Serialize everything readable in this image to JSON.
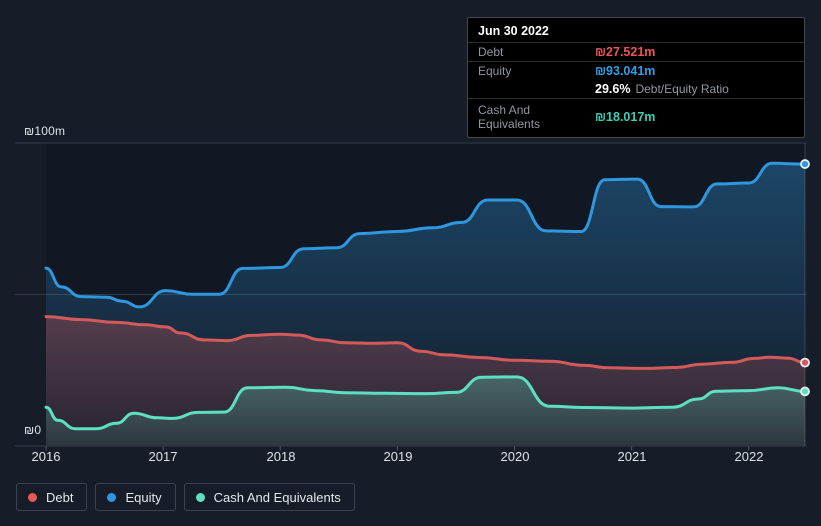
{
  "colors": {
    "background": "#161d28",
    "debt_line": "#d45a5a",
    "equity_line": "#2e97de",
    "cash_line": "#5ce0c1",
    "debt_value_text": "#eb5757",
    "equity_value_text": "#2e9fe6",
    "cash_value_text": "#38d1b7",
    "ratio_value_text": "#ffffff",
    "grid": "#303a47"
  },
  "tooltip": {
    "title": "Jun 30 2022",
    "debt_label": "Debt",
    "debt_value": "₪27.521m",
    "equity_label": "Equity",
    "equity_value": "₪93.041m",
    "ratio_value": "29.6%",
    "ratio_label": "Debt/Equity Ratio",
    "cash_label": "Cash And Equivalents",
    "cash_value": "₪18.017m"
  },
  "axis": {
    "y_top_label": "₪100m",
    "y_zero_label": "₪0",
    "years": [
      "2016",
      "2017",
      "2018",
      "2019",
      "2020",
      "2021",
      "2022"
    ]
  },
  "legend": {
    "items": [
      {
        "label": "Debt",
        "color": "#eb5757"
      },
      {
        "label": "Equity",
        "color": "#2e97de"
      },
      {
        "label": "Cash And Equivalents",
        "color": "#5ce0c1"
      }
    ]
  },
  "chart_data": {
    "type": "area",
    "title": "Debt, Equity and Cash history (₪ millions)",
    "x_range": [
      2016.0,
      2022.48
    ],
    "ylim": [
      0,
      100
    ],
    "y_unit": "₪m",
    "gridlines_y": [
      0,
      50,
      100
    ],
    "x_ticks": [
      2016,
      2017,
      2018,
      2019,
      2020,
      2021,
      2022
    ],
    "legend_position": "bottom-left",
    "last_point_date": "Jun 30 2022",
    "series": [
      {
        "name": "Equity",
        "color": "#2e97de",
        "points": [
          [
            2016.0,
            58.7
          ],
          [
            2016.13,
            52.5
          ],
          [
            2016.3,
            49.3
          ],
          [
            2016.52,
            49.1
          ],
          [
            2016.65,
            47.8
          ],
          [
            2016.8,
            45.9
          ],
          [
            2017.02,
            51.3
          ],
          [
            2017.25,
            50.1
          ],
          [
            2017.48,
            50.1
          ],
          [
            2017.68,
            58.6
          ],
          [
            2018.0,
            58.9
          ],
          [
            2018.2,
            65.1
          ],
          [
            2018.48,
            65.4
          ],
          [
            2018.68,
            70.1
          ],
          [
            2019.0,
            70.8
          ],
          [
            2019.3,
            72.0
          ],
          [
            2019.55,
            73.8
          ],
          [
            2019.77,
            81.2
          ],
          [
            2020.02,
            81.2
          ],
          [
            2020.27,
            71.0
          ],
          [
            2020.57,
            70.8
          ],
          [
            2020.77,
            87.9
          ],
          [
            2021.05,
            88.1
          ],
          [
            2021.25,
            79.0
          ],
          [
            2021.53,
            78.9
          ],
          [
            2021.73,
            86.5
          ],
          [
            2022.0,
            86.8
          ],
          [
            2022.2,
            93.3
          ],
          [
            2022.48,
            93.041
          ]
        ]
      },
      {
        "name": "Debt",
        "color": "#d45a5a",
        "points": [
          [
            2016.0,
            42.7
          ],
          [
            2016.3,
            41.7
          ],
          [
            2016.6,
            40.8
          ],
          [
            2016.85,
            40.0
          ],
          [
            2017.02,
            39.3
          ],
          [
            2017.15,
            37.3
          ],
          [
            2017.35,
            35.0
          ],
          [
            2017.55,
            34.8
          ],
          [
            2017.75,
            36.5
          ],
          [
            2018.0,
            36.9
          ],
          [
            2018.15,
            36.6
          ],
          [
            2018.35,
            35.0
          ],
          [
            2018.55,
            34.1
          ],
          [
            2018.8,
            33.9
          ],
          [
            2019.0,
            34.1
          ],
          [
            2019.2,
            31.3
          ],
          [
            2019.4,
            30.1
          ],
          [
            2019.7,
            29.2
          ],
          [
            2020.0,
            28.3
          ],
          [
            2020.3,
            28.0
          ],
          [
            2020.6,
            26.6
          ],
          [
            2020.8,
            25.8
          ],
          [
            2021.1,
            25.6
          ],
          [
            2021.38,
            25.9
          ],
          [
            2021.6,
            27.0
          ],
          [
            2021.85,
            27.6
          ],
          [
            2022.05,
            28.9
          ],
          [
            2022.18,
            29.3
          ],
          [
            2022.33,
            29.0
          ],
          [
            2022.48,
            27.521
          ]
        ]
      },
      {
        "name": "Cash And Equivalents",
        "color": "#5ce0c1",
        "points": [
          [
            2016.0,
            12.8
          ],
          [
            2016.1,
            8.5
          ],
          [
            2016.25,
            5.7
          ],
          [
            2016.43,
            5.7
          ],
          [
            2016.6,
            7.5
          ],
          [
            2016.75,
            10.8
          ],
          [
            2016.95,
            9.3
          ],
          [
            2017.08,
            9.1
          ],
          [
            2017.3,
            11.1
          ],
          [
            2017.52,
            11.2
          ],
          [
            2017.72,
            19.2
          ],
          [
            2018.05,
            19.4
          ],
          [
            2018.3,
            18.3
          ],
          [
            2018.55,
            17.6
          ],
          [
            2018.9,
            17.4
          ],
          [
            2019.25,
            17.3
          ],
          [
            2019.5,
            17.7
          ],
          [
            2019.72,
            22.7
          ],
          [
            2020.02,
            22.8
          ],
          [
            2020.3,
            13.1
          ],
          [
            2020.6,
            12.7
          ],
          [
            2021.0,
            12.5
          ],
          [
            2021.35,
            12.8
          ],
          [
            2021.57,
            15.5
          ],
          [
            2021.72,
            18.1
          ],
          [
            2022.0,
            18.3
          ],
          [
            2022.25,
            19.2
          ],
          [
            2022.48,
            18.017
          ]
        ]
      }
    ]
  }
}
